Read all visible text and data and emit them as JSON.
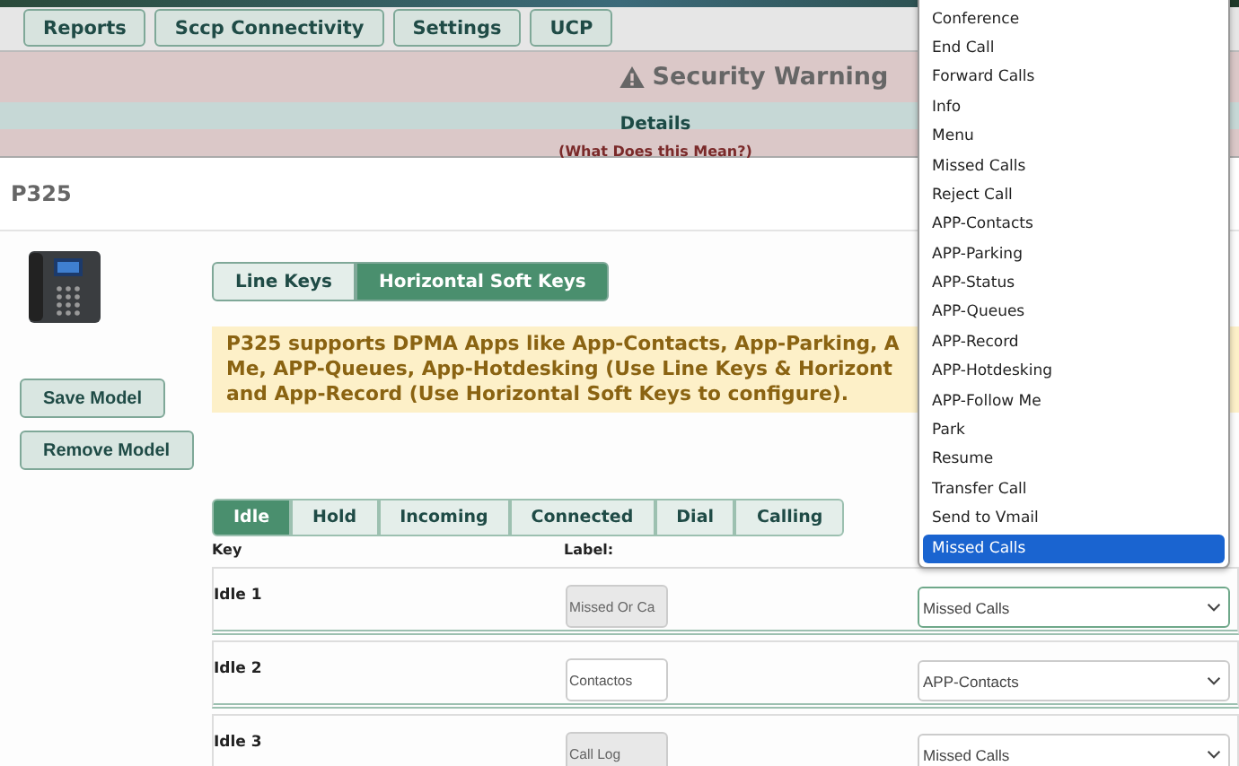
{
  "nav_tabs": [
    "Reports",
    "Sccp Connectivity",
    "Settings",
    "UCP"
  ],
  "security_warning": {
    "title": "Security Warning",
    "details": "Details",
    "link": "(What Does this Mean?)"
  },
  "model": {
    "name": "P325"
  },
  "key_type_tabs": [
    {
      "label": "Line Keys",
      "selected": false
    },
    {
      "label": "Horizontal Soft Keys",
      "selected": true
    }
  ],
  "notice_lines": [
    "P325 supports DPMA Apps like App-Contacts, App-Parking, A",
    "Me, APP-Queues, App-Hotdesking (Use Line Keys & Horizont",
    "and App-Record (Use Horizontal Soft Keys to configure)."
  ],
  "buttons": [
    "Save Model",
    "Remove Model"
  ],
  "state_tabs": [
    {
      "label": "Idle",
      "selected": true
    },
    {
      "label": "Hold",
      "selected": false
    },
    {
      "label": "Incoming",
      "selected": false
    },
    {
      "label": "Connected",
      "selected": false
    },
    {
      "label": "Dial",
      "selected": false
    },
    {
      "label": "Calling",
      "selected": false
    }
  ],
  "table": {
    "columns": [
      "Key",
      "Label:"
    ],
    "rows": [
      {
        "key": "Idle 1",
        "label": "Missed Or Ca",
        "disabled": true,
        "action": "Missed Calls",
        "open": true,
        "options": [
          {
            "label": "Conference",
            "selected": false
          },
          {
            "label": "End Call",
            "selected": false
          },
          {
            "label": "Forward Calls",
            "selected": false
          },
          {
            "label": "Info",
            "selected": false
          },
          {
            "label": "Menu",
            "selected": false
          },
          {
            "label": "Missed Calls",
            "selected": false
          },
          {
            "label": "Reject Call",
            "selected": false
          },
          {
            "label": "APP-Contacts",
            "selected": false
          },
          {
            "label": "APP-Parking",
            "selected": false
          },
          {
            "label": "APP-Status",
            "selected": false
          },
          {
            "label": "APP-Queues",
            "selected": false
          },
          {
            "label": "APP-Record",
            "selected": false
          },
          {
            "label": "APP-Hotdesking",
            "selected": false
          },
          {
            "label": "APP-Follow Me",
            "selected": false
          },
          {
            "label": "Park",
            "selected": false
          },
          {
            "label": "Resume",
            "selected": false
          },
          {
            "label": "Transfer Call",
            "selected": false
          },
          {
            "label": "Send to Vmail",
            "selected": false
          },
          {
            "label": "Missed Calls",
            "selected": true
          }
        ]
      },
      {
        "key": "Idle 2",
        "label": "Contactos",
        "disabled": false,
        "action": "APP-Contacts",
        "open": false
      },
      {
        "key": "Idle 3",
        "label": "Call Log",
        "disabled": true,
        "action": "Missed Calls",
        "open": false
      }
    ]
  }
}
